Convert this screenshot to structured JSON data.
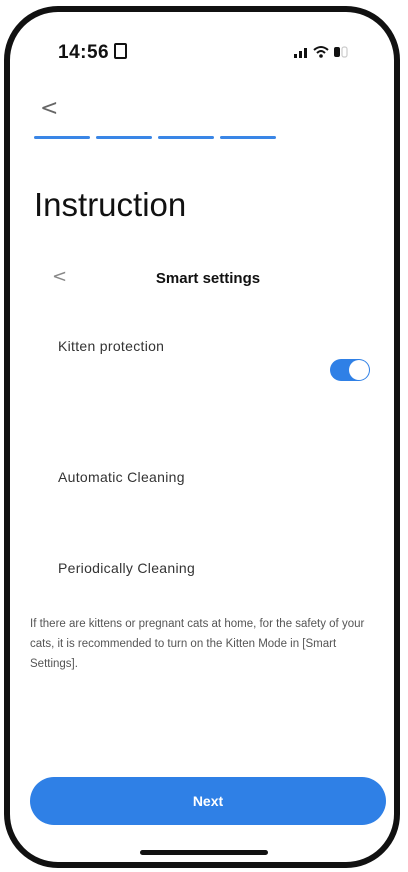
{
  "status_bar": {
    "time": "14:56",
    "icons": [
      "signal-icon",
      "wifi-icon",
      "battery-icon"
    ]
  },
  "header": {
    "back_label": "<",
    "steps_total": 4,
    "steps_complete": 4,
    "title": "Instruction"
  },
  "card": {
    "back_label": "<",
    "title": "Smart settings",
    "items": [
      {
        "label": "Kitten protection",
        "toggle_on": true
      },
      {
        "label": "Automatic Cleaning"
      },
      {
        "label": "Periodically Cleaning"
      }
    ]
  },
  "description": "If there are kittens or pregnant cats at home, for the safety of your cats, it is recommended to turn on the Kitten Mode in [Smart Settings].",
  "next_button": {
    "label": "Next"
  },
  "colors": {
    "accent": "#2f80e6",
    "text": "#111111"
  }
}
